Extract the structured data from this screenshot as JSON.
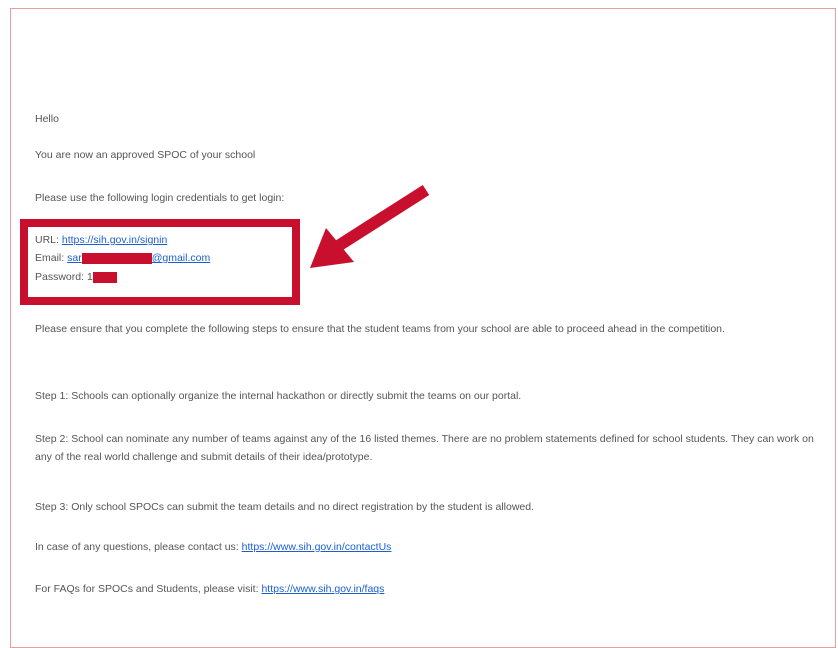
{
  "email": {
    "greeting": "Hello",
    "approved": "You are now an approved SPOC of your school",
    "credentials_intro": "Please use the following login credentials to get login:",
    "url_label": "URL:",
    "url_link": "https://sih.gov.in/signin",
    "email_label": "Email:",
    "email_prefix": "sar",
    "email_suffix": "@gmail.com",
    "password_label": "Password:",
    "password_prefix": "1",
    "ensure": "Please ensure that you complete the following steps to ensure that the student teams from your school are able to proceed ahead in the competition.",
    "step1": "Step 1: Schools can optionally organize the internal hackathon or directly submit the teams on our portal.",
    "step2": "Step 2: School can nominate any number of teams against any of the 16 listed themes. There are no problem statements defined for school students. They can work on any of the real world challenge and submit details of their idea/prototype.",
    "step3": "Step 3: Only school SPOCs can submit the team details and no direct registration by the student is allowed.",
    "questions_text": "In case of any questions, please contact us:",
    "questions_link": "https://www.sih.gov.in/contactUs",
    "faq_text": "For FAQs for SPOCs and Students, please visit:",
    "faq_link": "https://www.sih.gov.in/faqs"
  },
  "colors": {
    "highlight": "#c8102e",
    "link": "#1a5fd0",
    "text": "#555555"
  }
}
